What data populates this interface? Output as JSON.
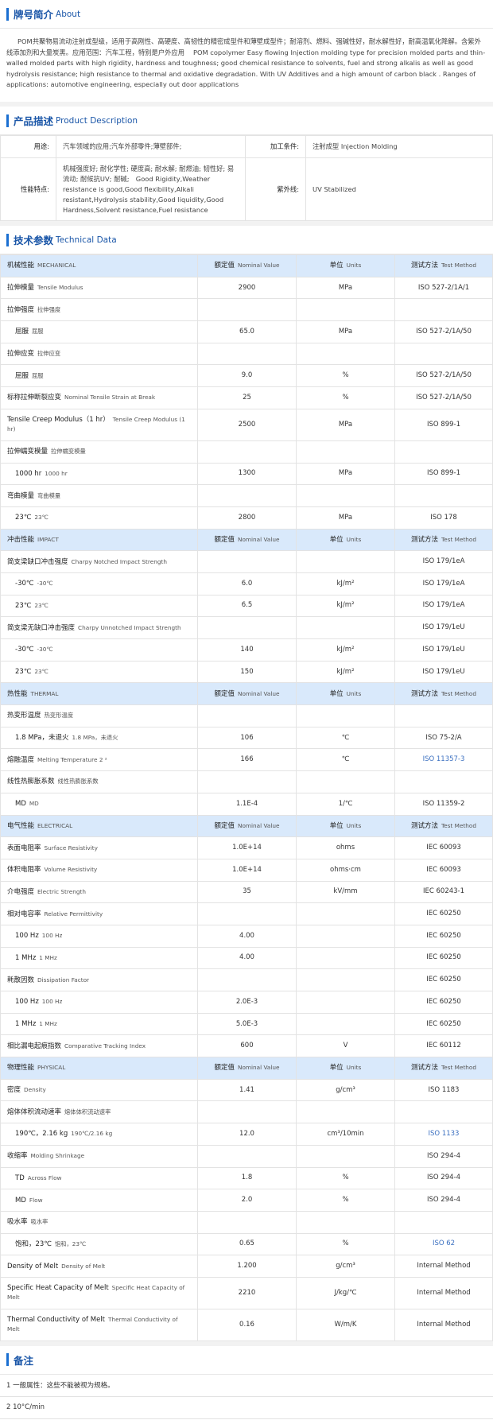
{
  "about": {
    "title_zh": "牌号简介",
    "title_en": "About",
    "text": "POM共聚物易流动注射成型级，适用于高刚性、高硬度、高韧性的精密成型件和薄壁成型件；耐溶剂、燃料、强碱性好，耐水解性好，耐高温氧化降解。含紫外线添加剂和大量炭黑。应用范围：汽车工程，特别是户外应用 　POM copolymer Easy flowing Injection molding type for precision molded parts and thin-walled molded parts with high rigidity, hardness and toughness; good chemical resistance to solvents, fuel and strong alkalis as well as good hydrolysis resistance; high resistance to thermal and oxidative degradation. With UV Additives and a high amount of carbon black . Ranges of applications: automotive engineering, especially out door applications"
  },
  "product": {
    "title_zh": "产品描述",
    "title_en": "Product Description",
    "rows": [
      {
        "l1": "用途:",
        "v1": "汽车领域的应用;汽车外部零件;薄壁部件;",
        "l2": "加工条件:",
        "v2": "注射成型  Injection Molding"
      },
      {
        "l1": "性能特点:",
        "v1": "机械强度好; 耐化学性; 硬度高; 耐水解; 耐燃油; 韧性好; 易流动; 耐候抗UV; 耐碱;　Good Rigidity,Weather resistance is good,Good flexibility,Alkali resistant,Hydrolysis stability,Good liquidity,Good Hardness,Solvent resistance,Fuel resistance",
        "l2": "紫外线:",
        "v2": "UV Stabilized"
      }
    ]
  },
  "tech": {
    "title_zh": "技术参数",
    "title_en": "Technical Data",
    "rows": [
      {
        "t": "h",
        "name": "机械性能",
        "sub": "MECHANICAL",
        "nv": "额定值",
        "nvs": "Nominal Value",
        "u": "单位",
        "us": "Units",
        "m": "测试方法",
        "ms": "Test Method"
      },
      {
        "name": "拉伸模量",
        "sub": "Tensile Modulus",
        "v": "2900",
        "u": "MPa",
        "m": "ISO 527-2/1A/1"
      },
      {
        "name": "拉伸强度",
        "sub": "拉伸强度",
        "v": "",
        "u": "",
        "m": ""
      },
      {
        "ind": true,
        "name": "屈服",
        "sub": "屈服",
        "v": "65.0",
        "u": "MPa",
        "m": "ISO 527-2/1A/50"
      },
      {
        "name": "拉伸应变",
        "sub": "拉伸应变",
        "v": "",
        "u": "",
        "m": ""
      },
      {
        "ind": true,
        "name": "屈服",
        "sub": "屈服",
        "v": "9.0",
        "u": "%",
        "m": "ISO 527-2/1A/50"
      },
      {
        "name": "标称拉伸断裂应变",
        "sub": "Nominal Tensile Strain at Break",
        "v": "25",
        "u": "%",
        "m": "ISO 527-2/1A/50"
      },
      {
        "tall": true,
        "name": "Tensile Creep Modulus（1 hr）",
        "sub": "Tensile Creep Modulus (1 hr)",
        "v": "2500",
        "u": "MPa",
        "m": "ISO 899-1"
      },
      {
        "name": "拉伸蠕变模量",
        "sub": "拉伸蠕变模量",
        "v": "",
        "u": "",
        "m": ""
      },
      {
        "ind": true,
        "name": "1000 hr",
        "sub": "1000 hr",
        "v": "1300",
        "u": "MPa",
        "m": "ISO 899-1"
      },
      {
        "name": "弯曲模量",
        "sub": "弯曲模量",
        "v": "",
        "u": "",
        "m": ""
      },
      {
        "ind": true,
        "name": "23℃",
        "sub": "23℃",
        "v": "2800",
        "u": "MPa",
        "m": "ISO 178"
      },
      {
        "t": "h",
        "name": "冲击性能",
        "sub": "IMPACT",
        "nv": "额定值",
        "nvs": "Nominal Value",
        "u": "单位",
        "us": "Units",
        "m": "测试方法",
        "ms": "Test Method"
      },
      {
        "name": "简支梁缺口冲击强度",
        "sub": "Charpy Notched Impact Strength",
        "v": "",
        "u": "",
        "m": "ISO 179/1eA"
      },
      {
        "ind": true,
        "name": "-30℃",
        "sub": "-30℃",
        "v": "6.0",
        "u": "kJ/m²",
        "m": "ISO 179/1eA"
      },
      {
        "ind": true,
        "name": "23℃",
        "sub": "23℃",
        "v": "6.5",
        "u": "kJ/m²",
        "m": "ISO 179/1eA"
      },
      {
        "name": "简支梁无缺口冲击强度",
        "sub": "Charpy Unnotched Impact Strength",
        "v": "",
        "u": "",
        "m": "ISO 179/1eU"
      },
      {
        "ind": true,
        "name": "-30℃",
        "sub": "-30℃",
        "v": "140",
        "u": "kJ/m²",
        "m": "ISO 179/1eU"
      },
      {
        "ind": true,
        "name": "23℃",
        "sub": "23℃",
        "v": "150",
        "u": "kJ/m²",
        "m": "ISO 179/1eU"
      },
      {
        "t": "h",
        "name": "热性能",
        "sub": "THERMAL",
        "nv": "额定值",
        "nvs": "Nominal Value",
        "u": "单位",
        "us": "Units",
        "m": "测试方法",
        "ms": "Test Method"
      },
      {
        "name": "热变形温度",
        "sub": "热变形温度",
        "v": "",
        "u": "",
        "m": ""
      },
      {
        "ind": true,
        "name": "1.8 MPa，未退火",
        "sub": "1.8 MPa，未退火",
        "v": "106",
        "u": "℃",
        "m": "ISO 75-2/A"
      },
      {
        "name": "熔融温度",
        "sub": "Melting Temperature  2 ²",
        "v": "166",
        "u": "℃",
        "m": "ISO 11357-3",
        "link": true
      },
      {
        "name": "线性热膨胀系数",
        "sub": "线性热膨胀系数",
        "v": "",
        "u": "",
        "m": ""
      },
      {
        "ind": true,
        "name": "MD",
        "sub": "MD",
        "v": "1.1E-4",
        "u": "1/℃",
        "m": "ISO 11359-2"
      },
      {
        "t": "h",
        "name": "电气性能",
        "sub": "ELECTRICAL",
        "nv": "额定值",
        "nvs": "Nominal Value",
        "u": "单位",
        "us": "Units",
        "m": "测试方法",
        "ms": "Test Method"
      },
      {
        "name": "表面电阻率",
        "sub": "Surface Resistivity",
        "v": "1.0E+14",
        "u": "ohms",
        "m": "IEC 60093"
      },
      {
        "name": "体积电阻率",
        "sub": "Volume Resistivity",
        "v": "1.0E+14",
        "u": "ohms·cm",
        "m": "IEC 60093"
      },
      {
        "name": "介电强度",
        "sub": "Electric Strength",
        "v": "35",
        "u": "kV/mm",
        "m": "IEC 60243-1"
      },
      {
        "name": "相对电容率",
        "sub": "Relative Permittivity",
        "v": "",
        "u": "",
        "m": "IEC 60250"
      },
      {
        "ind": true,
        "name": "100 Hz",
        "sub": "100 Hz",
        "v": "4.00",
        "u": "",
        "m": "IEC 60250"
      },
      {
        "ind": true,
        "name": "1 MHz",
        "sub": "1 MHz",
        "v": "4.00",
        "u": "",
        "m": "IEC 60250"
      },
      {
        "name": "耗散因数",
        "sub": "Dissipation Factor",
        "v": "",
        "u": "",
        "m": "IEC 60250"
      },
      {
        "ind": true,
        "name": "100 Hz",
        "sub": "100 Hz",
        "v": "2.0E-3",
        "u": "",
        "m": "IEC 60250"
      },
      {
        "ind": true,
        "name": "1 MHz",
        "sub": "1 MHz",
        "v": "5.0E-3",
        "u": "",
        "m": "IEC 60250"
      },
      {
        "name": "相比漏电起痕指数",
        "sub": "Comparative Tracking Index",
        "v": "600",
        "u": "V",
        "m": "IEC 60112"
      },
      {
        "t": "h",
        "name": "物理性能",
        "sub": "PHYSICAL",
        "nv": "额定值",
        "nvs": "Nominal Value",
        "u": "单位",
        "us": "Units",
        "m": "测试方法",
        "ms": "Test Method"
      },
      {
        "name": "密度",
        "sub": "Density",
        "v": "1.41",
        "u": "g/cm³",
        "m": "ISO 1183"
      },
      {
        "name": "熔体体积流动速率",
        "sub": "熔体体积流动速率",
        "v": "",
        "u": "",
        "m": ""
      },
      {
        "ind": true,
        "name": "190℃，2.16 kg",
        "sub": "190℃/2.16 kg",
        "v": "12.0",
        "u": "cm³/10min",
        "m": "ISO 1133",
        "link": true
      },
      {
        "name": "收缩率",
        "sub": "Molding Shrinkage",
        "v": "",
        "u": "",
        "m": "ISO 294-4"
      },
      {
        "ind": true,
        "name": "TD",
        "sub": "Across Flow",
        "v": "1.8",
        "u": "%",
        "m": "ISO 294-4"
      },
      {
        "ind": true,
        "name": "MD",
        "sub": "Flow",
        "v": "2.0",
        "u": "%",
        "m": "ISO 294-4"
      },
      {
        "name": "吸水率",
        "sub": "吸水率",
        "v": "",
        "u": "",
        "m": ""
      },
      {
        "ind": true,
        "name": "饱和，23℃",
        "sub": "饱和，23℃",
        "v": "0.65",
        "u": "%",
        "m": "ISO 62",
        "link": true
      },
      {
        "name": "Density of Melt",
        "sub": "Density of Melt",
        "v": "1.200",
        "u": "g/cm³",
        "m": "Internal Method"
      },
      {
        "tall": true,
        "name": "Specific Heat Capacity of Melt",
        "sub": "Specific Heat Capacity of Melt",
        "v": "2210",
        "u": "J/kg/℃",
        "m": "Internal Method"
      },
      {
        "tall": true,
        "name": "Thermal Conductivity of Melt",
        "sub": "Thermal Conductivity of Melt",
        "v": "0.16",
        "u": "W/m/K",
        "m": "Internal Method"
      }
    ]
  },
  "notes": {
    "title_zh": "备注",
    "items": [
      "1 一般属性：这些不能被视为规格。",
      "2 10°C/min"
    ]
  }
}
